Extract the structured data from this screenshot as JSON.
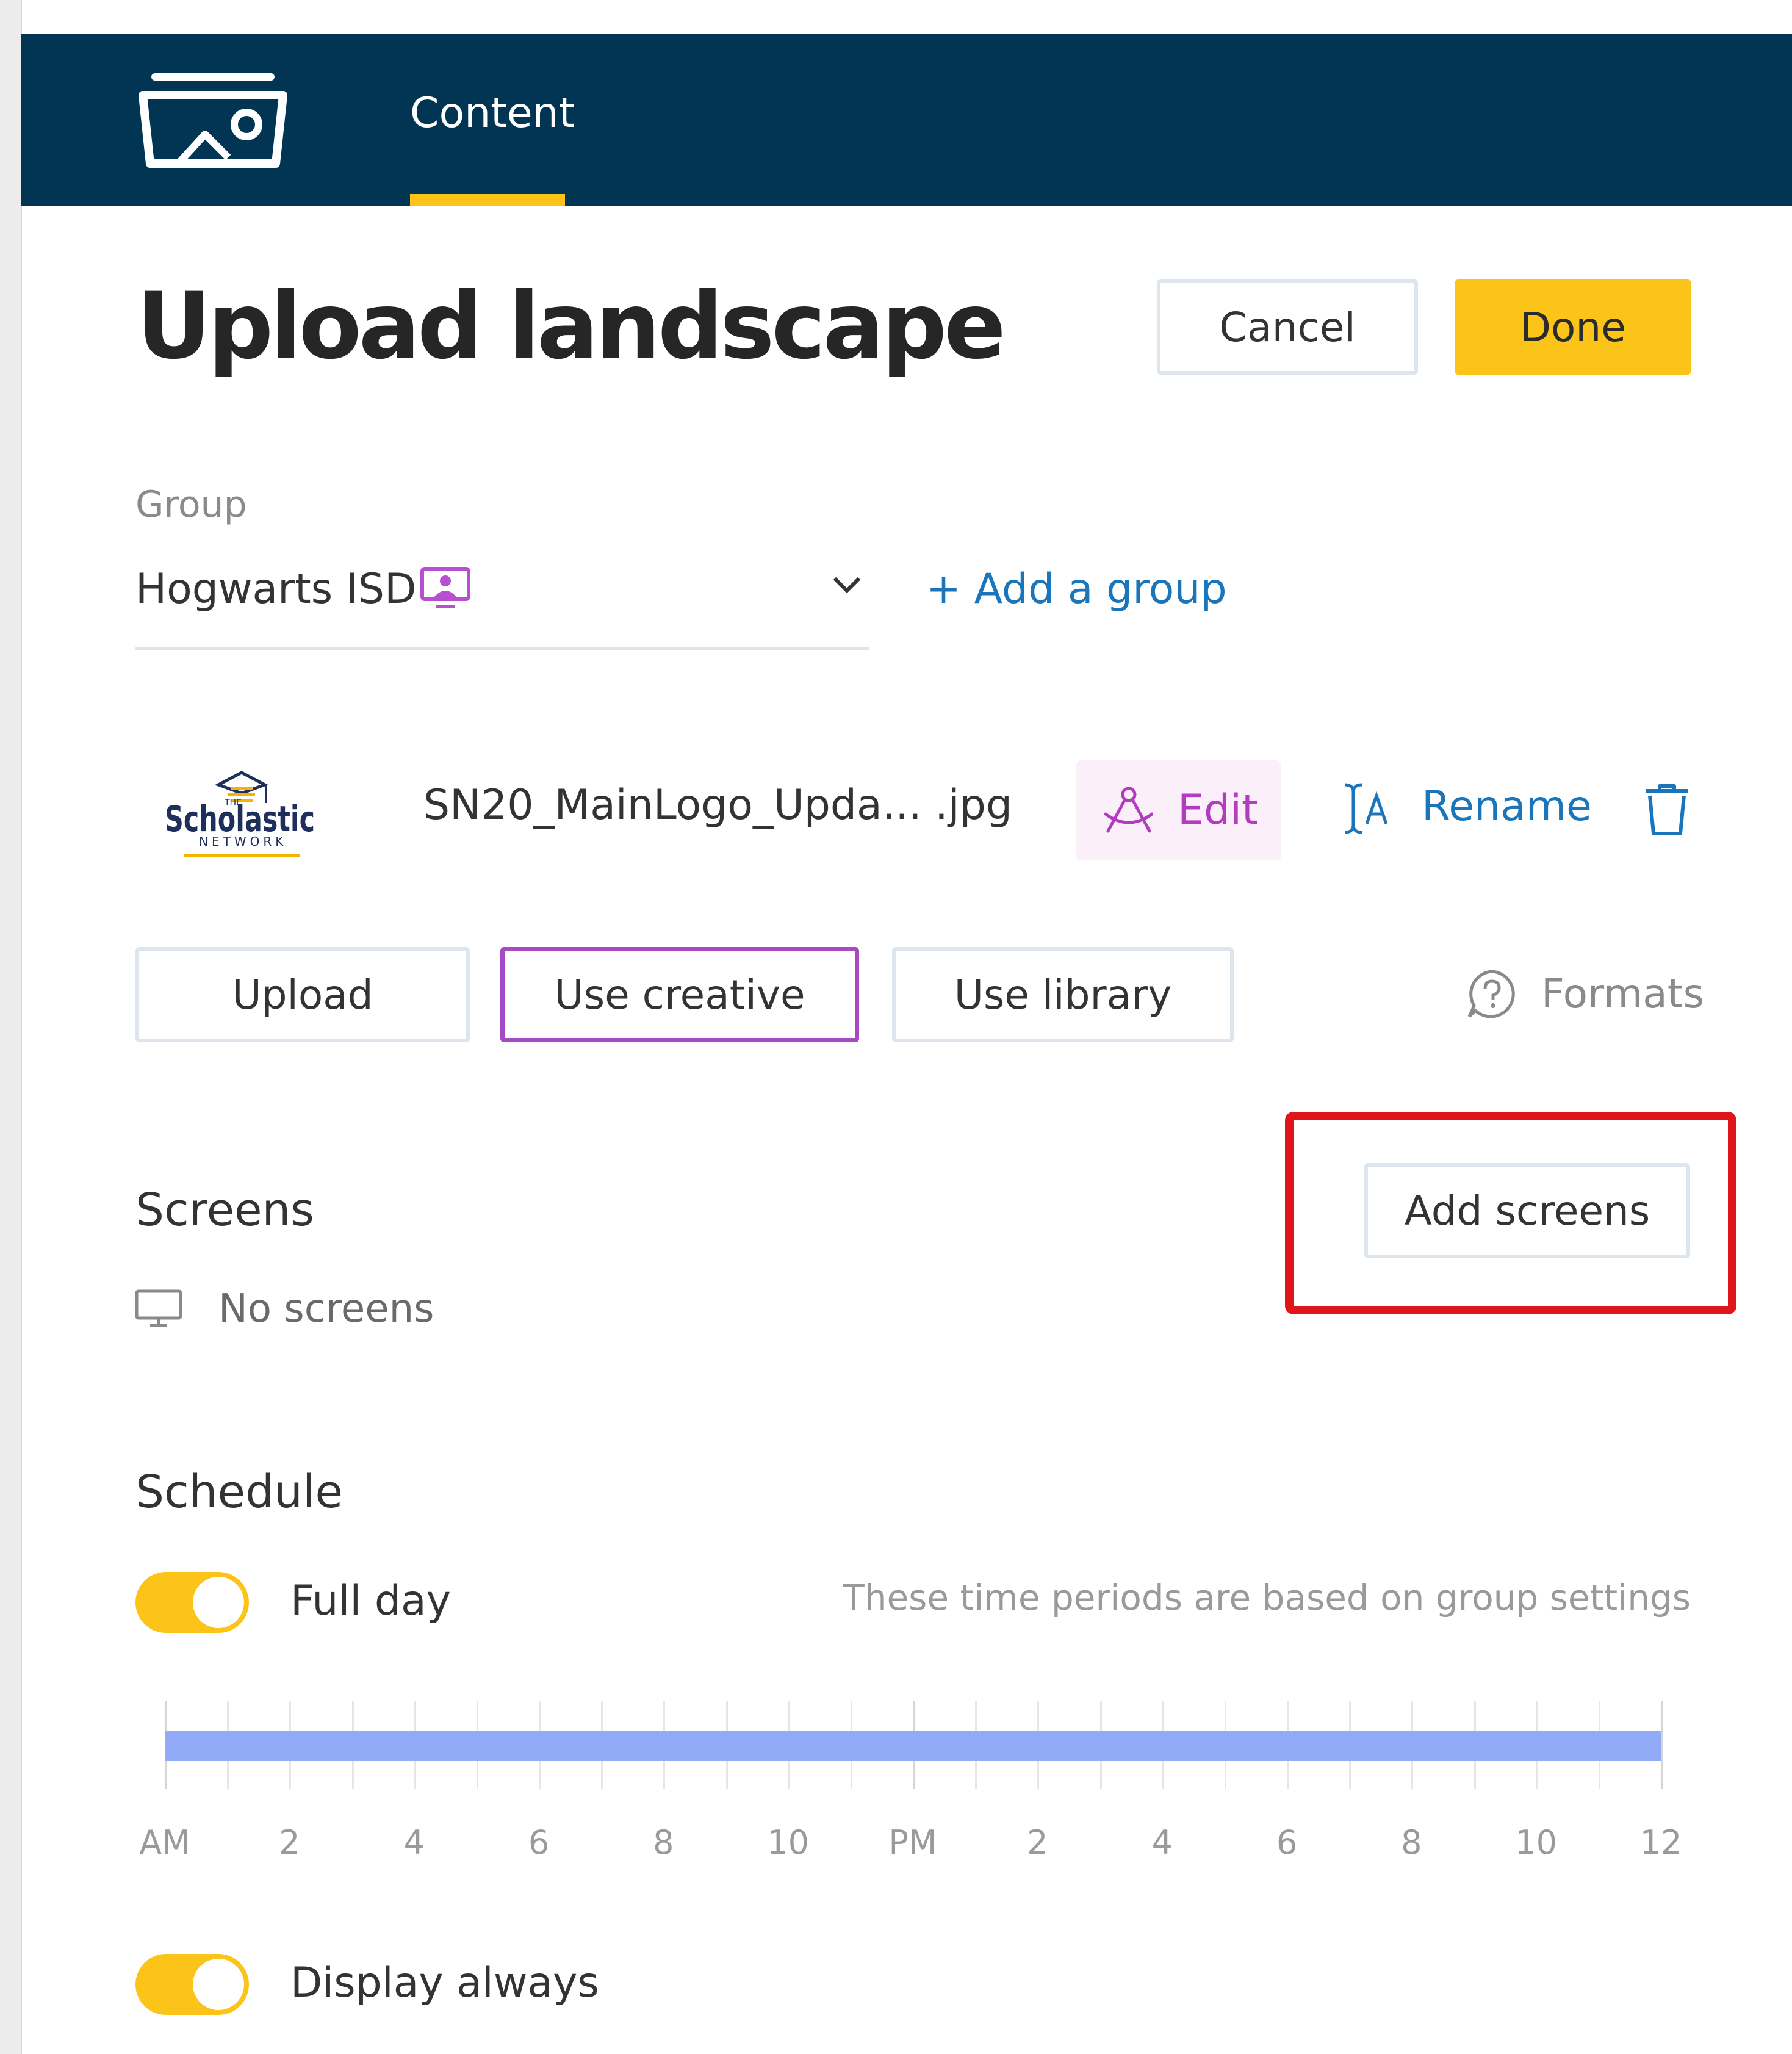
{
  "nav": {
    "tab_content": "Content"
  },
  "header": {
    "title": "Upload landscape",
    "cancel_label": "Cancel",
    "done_label": "Done"
  },
  "group": {
    "label": "Group",
    "value": "Hogwarts ISD",
    "add_label": "+ Add a group"
  },
  "file": {
    "name": "SN20_MainLogo_Upda... .jpg",
    "edit_label": "Edit",
    "rename_label": "Rename",
    "thumb_brand": "Scholastic",
    "thumb_the": "THE",
    "thumb_sub": "NETWORK"
  },
  "source": {
    "upload_label": "Upload",
    "creative_label": "Use creative",
    "library_label": "Use library",
    "formats_label": "Formats"
  },
  "screens": {
    "title": "Screens",
    "empty_label": "No screens",
    "add_label": "Add screens"
  },
  "schedule": {
    "title": "Schedule",
    "full_day_label": "Full day",
    "full_day_on": true,
    "hint": "These time periods are based on group settings",
    "display_always_label": "Display always",
    "display_always_on": true,
    "timeline_labels": [
      "AM",
      "2",
      "4",
      "6",
      "8",
      "10",
      "PM",
      "2",
      "4",
      "6",
      "8",
      "10",
      "12"
    ],
    "active_range_hours": [
      0,
      24
    ]
  },
  "colors": {
    "nav_bg": "#023554",
    "accent": "#fcc419",
    "link": "#1a75bb",
    "edit": "#b23bbf",
    "timeline_bar": "#91abf9",
    "highlight": "#e0151a"
  },
  "icons": {
    "logo": "photo-frame-icon",
    "group": "screen-group-icon",
    "chevron": "chevron-down-icon",
    "edit": "edit-creative-icon",
    "rename": "rename-icon",
    "trash": "trash-icon",
    "formats": "help-circle-icon",
    "monitor": "monitor-icon"
  }
}
